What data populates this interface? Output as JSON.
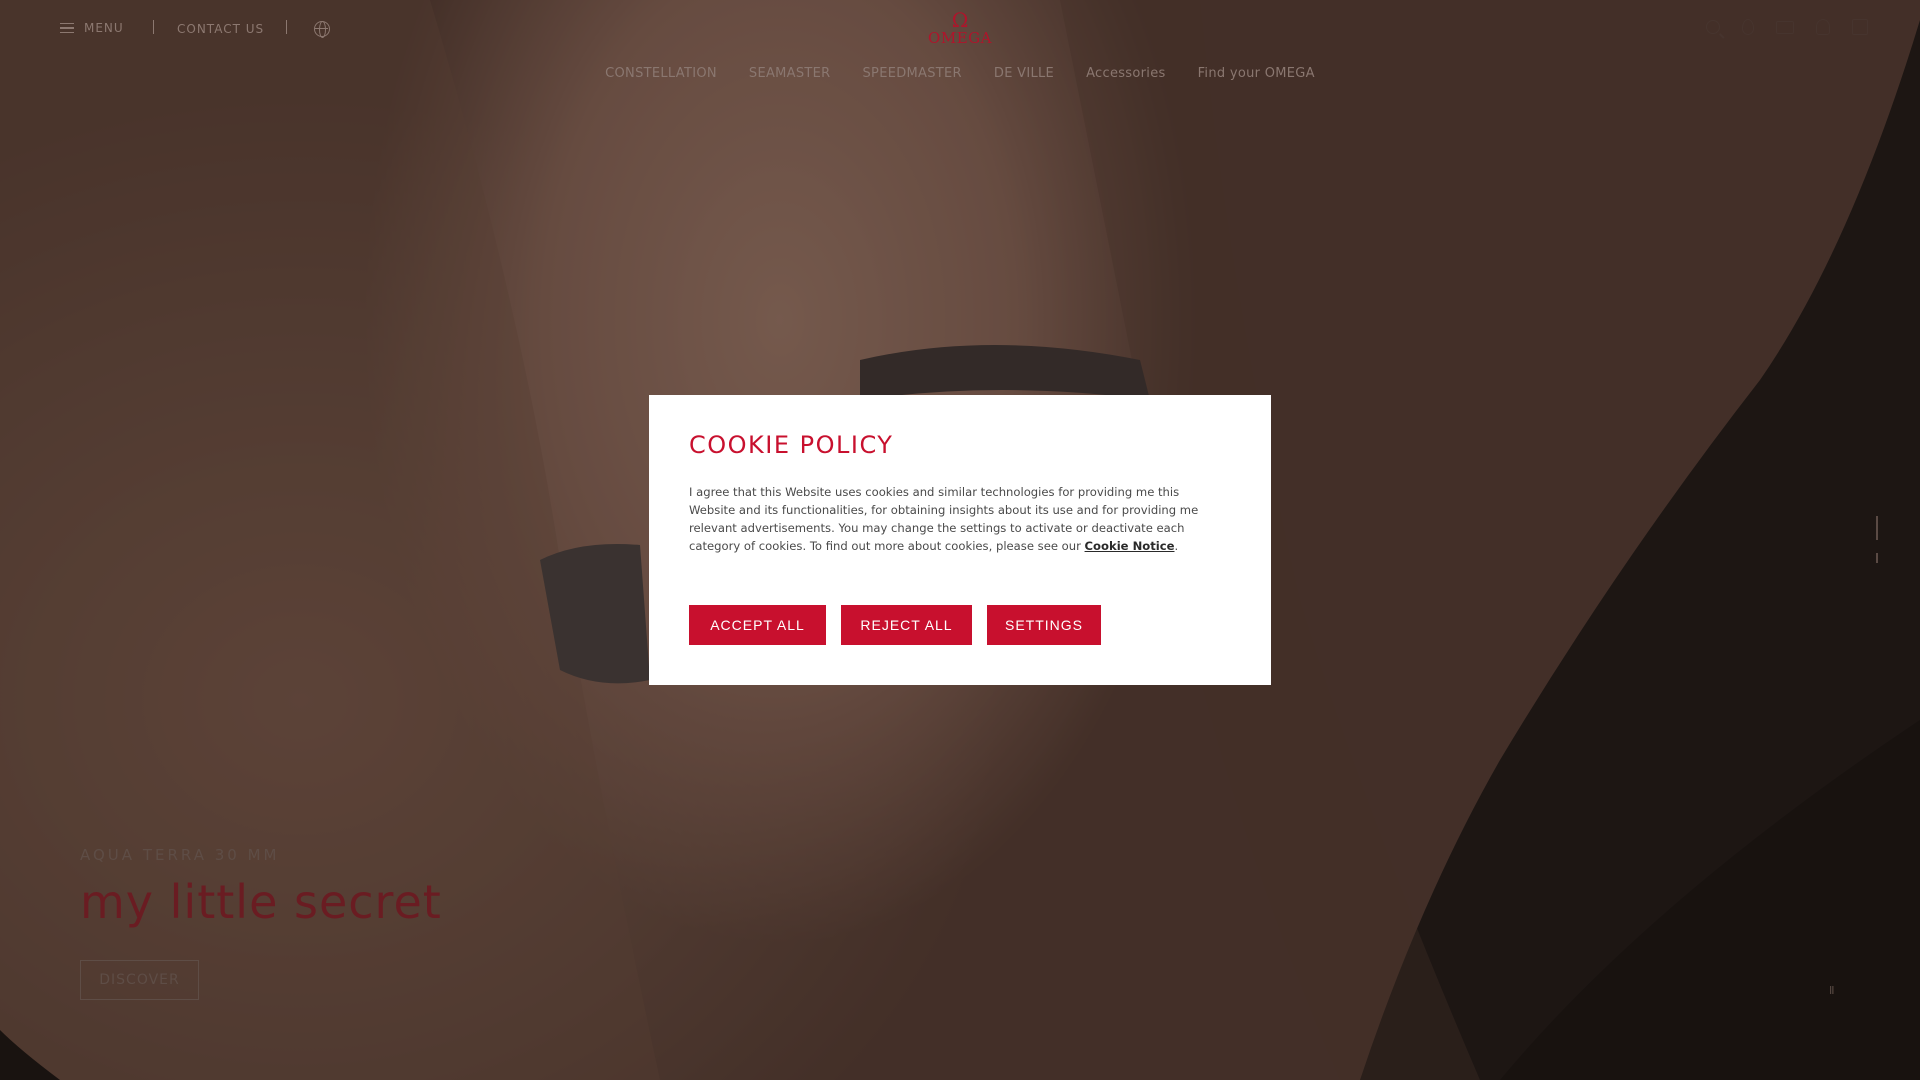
{
  "header": {
    "menu_label": "MENU",
    "contact_label": "CONTACT US",
    "logo_symbol": "Ω",
    "logo_text": "OMEGA",
    "right_icons": [
      "search-icon",
      "store-locator-icon",
      "chat-icon",
      "account-icon",
      "bag-icon"
    ]
  },
  "nav": {
    "items": [
      {
        "label": "CONSTELLATION"
      },
      {
        "label": "SEAMASTER"
      },
      {
        "label": "SPEEDMASTER"
      },
      {
        "label": "DE VILLE"
      },
      {
        "label": "Accessories"
      },
      {
        "label": "Find your OMEGA"
      }
    ]
  },
  "hero": {
    "eyebrow": "AQUA TERRA 30 MM",
    "headline": "my little secret",
    "cta_label": "DISCOVER",
    "pause_glyph": "II"
  },
  "cookie_modal": {
    "title": "COOKIE POLICY",
    "body_prefix": "I agree that this Website uses cookies and similar technologies for providing me this Website and its functionalities, for obtaining insights about its use and for providing me relevant advertisements. You may change the settings to activate or deactivate each category of cookies. To find out more about cookies, please see our ",
    "body_link": "Cookie Notice",
    "body_suffix": ".",
    "accept_label": "ACCEPT ALL",
    "reject_label": "REJECT ALL",
    "settings_label": "SETTINGS"
  },
  "colors": {
    "brand_red": "#c8102e",
    "modal_bg": "#ffffff"
  }
}
